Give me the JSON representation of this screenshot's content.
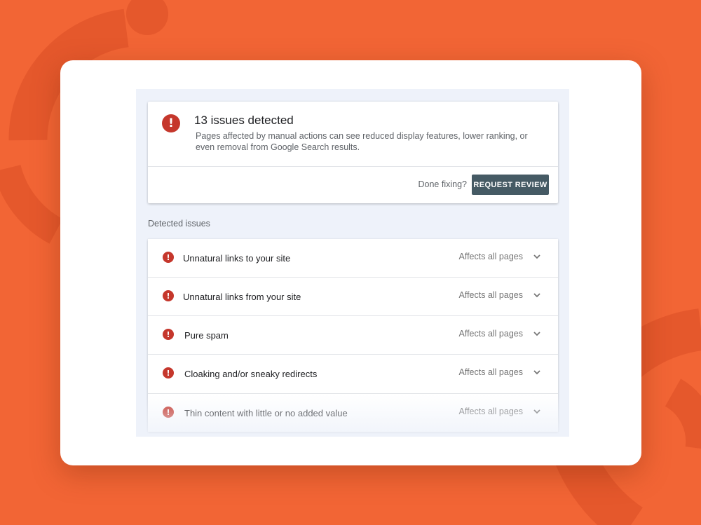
{
  "summary": {
    "title": "13 issues detected",
    "description": "Pages affected by manual actions can see reduced display features, lower ranking, or even removal from Google Search results.",
    "done_label": "Done fixing?",
    "request_review_label": "REQUEST REVIEW",
    "icon": "error-icon"
  },
  "issues_section": {
    "label": "Detected issues",
    "items": [
      {
        "title": "Unnatural links to your site",
        "scope": "Affects all pages"
      },
      {
        "title": "Unnatural links from your site",
        "scope": "Affects all pages"
      },
      {
        "title": "Pure spam",
        "scope": "Affects all pages"
      },
      {
        "title": "Cloaking and/or sneaky redirects",
        "scope": "Affects all pages"
      },
      {
        "title": "Thin content with little or no added value",
        "scope": "Affects all pages"
      }
    ]
  },
  "colors": {
    "background": "#f26535",
    "error": "#c5372c",
    "button": "#455a64"
  }
}
